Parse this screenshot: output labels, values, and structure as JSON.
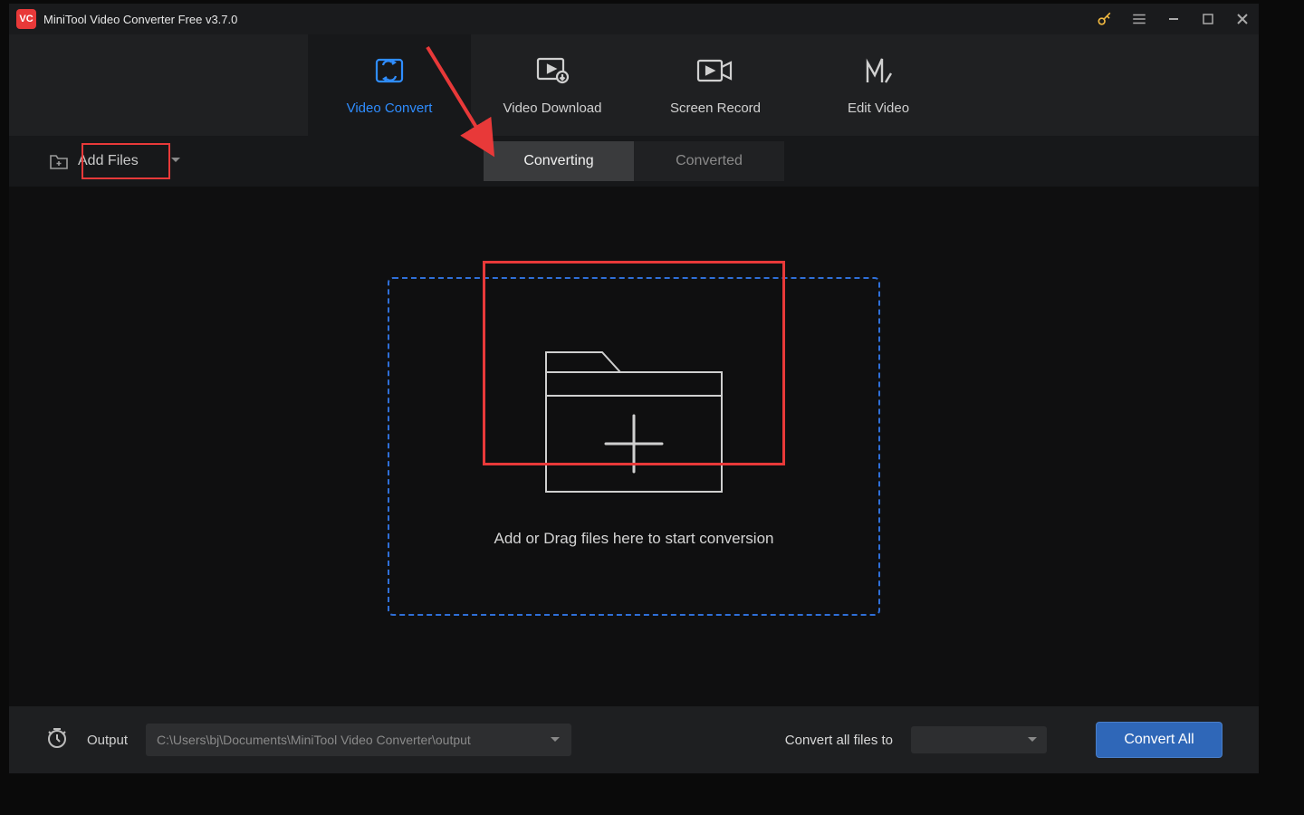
{
  "titlebar": {
    "app_name": "MiniTool Video Converter Free v3.7.0"
  },
  "nav": {
    "items": [
      {
        "label": "Video Convert"
      },
      {
        "label": "Video Download"
      },
      {
        "label": "Screen Record"
      },
      {
        "label": "Edit Video"
      }
    ]
  },
  "toolbar": {
    "add_files_label": "Add Files"
  },
  "subtabs": {
    "converting": "Converting",
    "converted": "Converted"
  },
  "dropzone": {
    "caption": "Add or Drag files here to start conversion"
  },
  "bottom": {
    "output_label": "Output",
    "output_path": "C:\\Users\\bj\\Documents\\MiniTool Video Converter\\output",
    "convert_all_label": "Convert all files to",
    "convert_all_btn": "Convert All"
  }
}
